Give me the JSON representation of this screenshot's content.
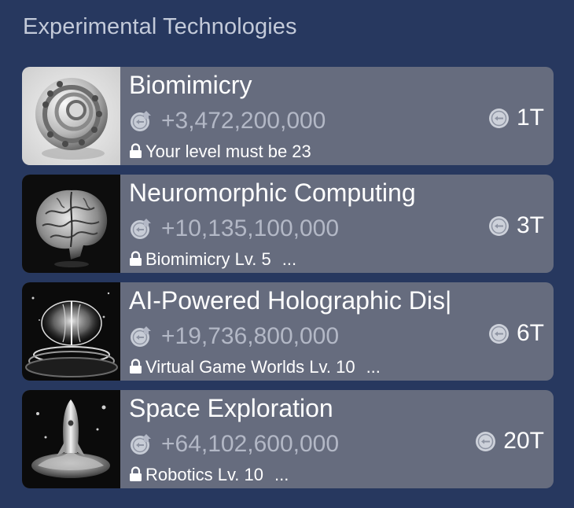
{
  "section": {
    "title": "Experimental Technologies"
  },
  "colors": {
    "background": "#27385f",
    "card": "#666c7e",
    "income_text": "#b3b8c6",
    "title_text": "#c3cad9"
  },
  "icons": {
    "income": "coin-with-up-arrow-icon",
    "cost": "coin-icon",
    "lock": "lock-icon"
  },
  "technologies": [
    {
      "name": "Biomimicry",
      "image": "spiral-shell-sculpture",
      "income": "+3,472,200,000",
      "requirement": "Your level must be 23",
      "requirement_more": "",
      "cost": "1T"
    },
    {
      "name": "Neuromorphic Computing",
      "image": "brain-sculpture",
      "income": "+10,135,100,000",
      "requirement": "Biomimicry Lv. 5",
      "requirement_more": "...",
      "cost": "3T"
    },
    {
      "name": "AI-Powered Holographic Dis|",
      "image": "holographic-device",
      "income": "+19,736,800,000",
      "requirement": "Virtual Game Worlds Lv. 10",
      "requirement_more": "...",
      "cost": "6T"
    },
    {
      "name": "Space Exploration",
      "image": "rocket-launch",
      "income": "+64,102,600,000",
      "requirement": "Robotics Lv. 10",
      "requirement_more": "...",
      "cost": "20T"
    }
  ]
}
